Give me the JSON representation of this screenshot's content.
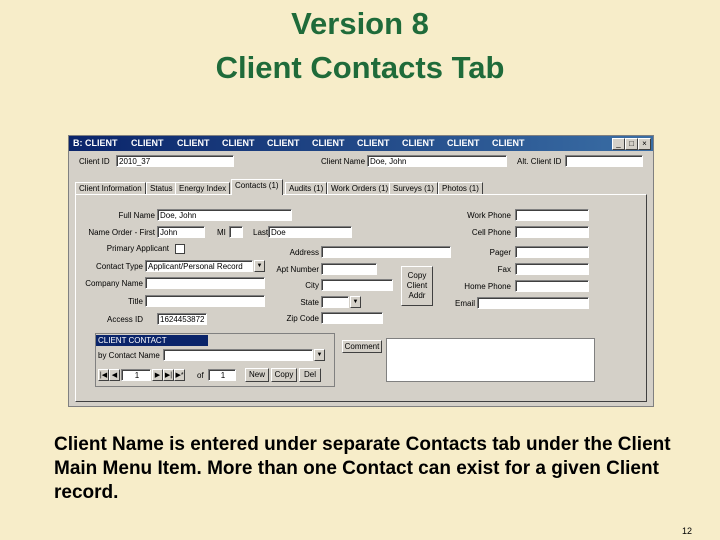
{
  "slide": {
    "title_line1": "Version 8",
    "title_line2": "Client Contacts Tab",
    "caption": "Client Name is entered under separate Contacts tab under the Client Main Menu Item.  More than one Contact can exist for a given Client record.",
    "page_number": "12",
    "colors": {
      "background": "#f7edc9",
      "title": "#1f6b3a",
      "titlebar": "#0a246a",
      "window": "#d4d0c8"
    }
  },
  "window": {
    "title_items": [
      "B: CLIENT",
      "CLIENT",
      "CLIENT",
      "CLIENT",
      "CLIENT",
      "CLIENT",
      "CLIENT",
      "CLIENT",
      "CLIENT",
      "CLIENT"
    ],
    "controls": {
      "minimize": "_",
      "maximize": "□",
      "close": "×"
    }
  },
  "header": {
    "client_id_label": "Client ID",
    "client_id_value": "2010_37",
    "client_name_label": "Client Name",
    "client_name_value": "Doe, John",
    "alt_client_id_label": "Alt. Client ID",
    "alt_client_id_value": ""
  },
  "tabs": [
    "Client Information",
    "Status",
    "Energy Index",
    "Contacts (1)",
    "Audits (1)",
    "Work Orders (1)",
    "Surveys (1)",
    "Photos (1)"
  ],
  "active_tab": "Contacts (1)",
  "form": {
    "full_name_label": "Full Name",
    "full_name_value": "Doe, John",
    "name_first_label": "Name Order - First",
    "first_value": "John",
    "mi_label": "MI",
    "mi_value": "",
    "last_label": "Last",
    "last_value": "Doe",
    "primary_applicant_label": "Primary Applicant",
    "contact_type_label": "Contact Type",
    "contact_type_value": "Applicant/Personal Record",
    "company_name_label": "Company Name",
    "title_label": "Title",
    "access_id_label": "Access ID",
    "access_id_value": "1624453872",
    "address_label": "Address",
    "apt_number_label": "Apt Number",
    "city_label": "City",
    "state_label": "State",
    "zip_label": "Zip Code",
    "copy_client_addr_label": "Copy Client Addr",
    "work_phone_label": "Work Phone",
    "cell_phone_label": "Cell Phone",
    "pager_label": "Pager",
    "fax_label": "Fax",
    "home_phone_label": "Home Phone",
    "email_label": "Email",
    "comment_label": "Comment"
  },
  "client_contact": {
    "header": "CLIENT CONTACT",
    "by_contact_name_label": "by Contact Name",
    "record_value": "1",
    "of_label": "of",
    "of_value": "1",
    "new_label": "New",
    "copy_label": "Copy",
    "del_label": "Del"
  }
}
